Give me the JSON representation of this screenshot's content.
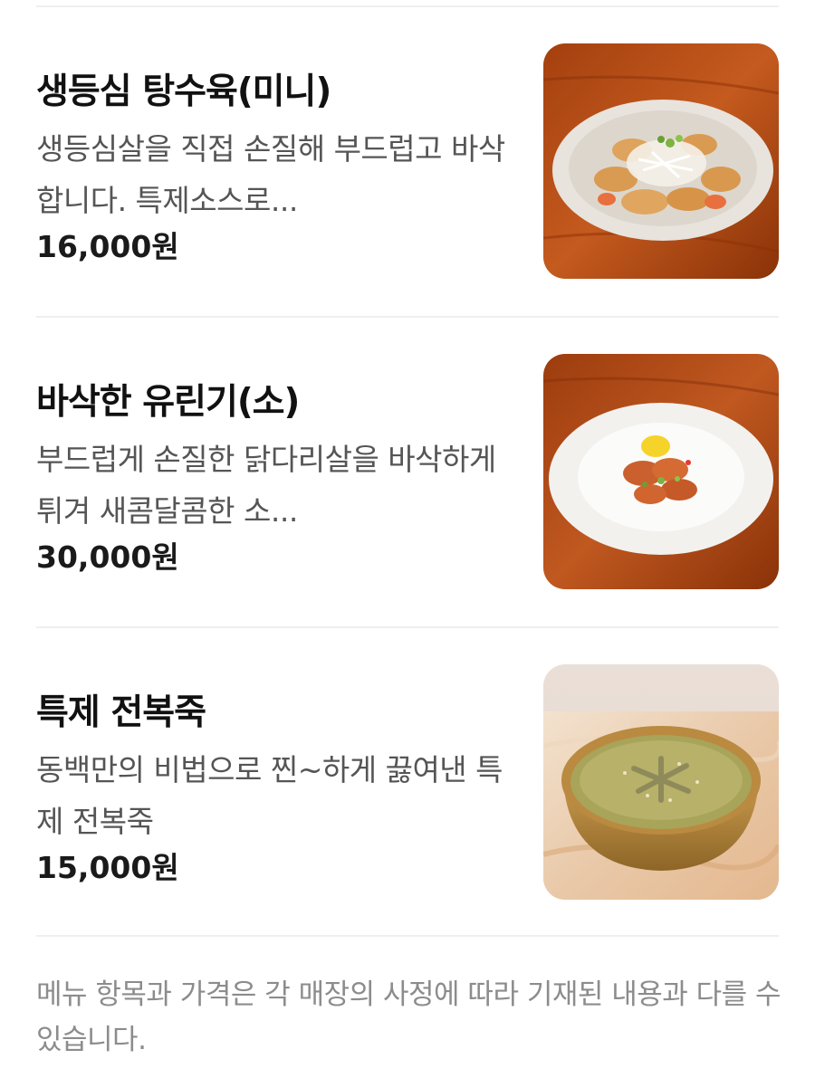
{
  "menu": {
    "items": [
      {
        "name": "생등심 탕수육(미니)",
        "description": "생등심살을 직접 손질해 부드럽고 바삭합니다. 특제소스로...",
        "price": "16,000원",
        "photo_icon": "sweet-sour-pork-photo"
      },
      {
        "name": "바삭한 유린기(소)",
        "description": "부드럽게 손질한 닭다리살을 바삭하게 튀겨 새콤달콤한 소...",
        "price": "30,000원",
        "photo_icon": "yuringi-chicken-photo"
      },
      {
        "name": "특제 전복죽",
        "description": "동백만의 비법으로 찐~하게 끓여낸 특제 전복죽",
        "price": "15,000원",
        "photo_icon": "abalone-porridge-photo"
      }
    ]
  },
  "footer": {
    "notice": "메뉴 항목과 가격은 각 매장의 사정에 따라 기재된 내용과 다를 수 있습니다."
  },
  "colors": {
    "text_primary": "#111111",
    "text_secondary": "#555555",
    "text_muted": "#8c8c8c",
    "divider": "#efefef"
  }
}
